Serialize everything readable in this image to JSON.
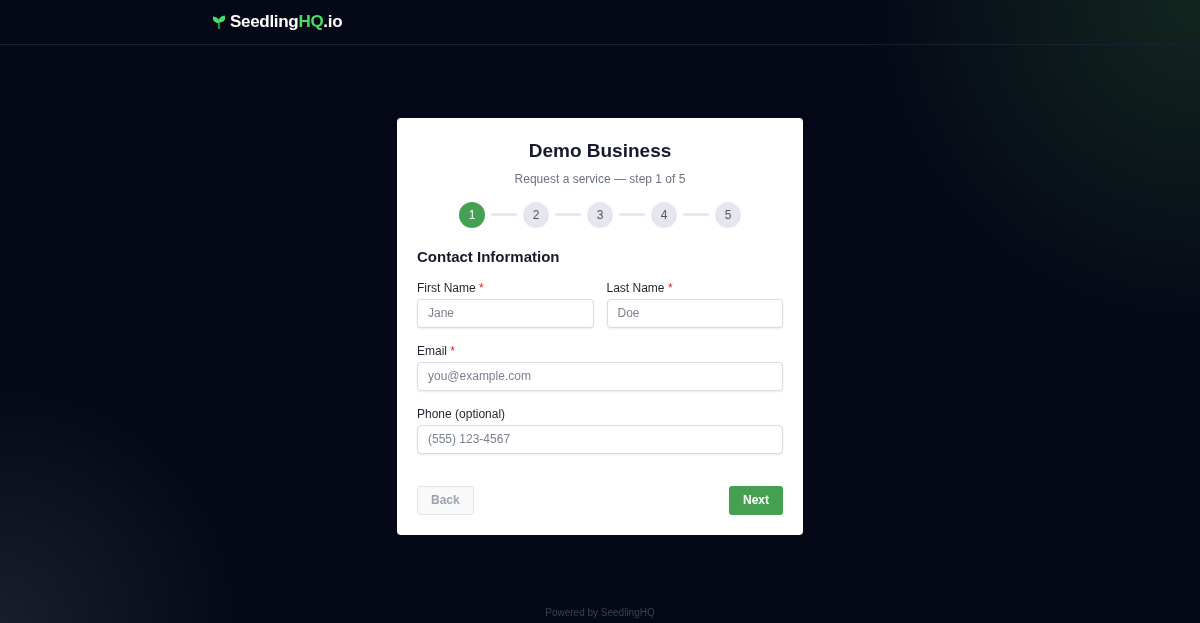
{
  "header": {
    "logo": {
      "name": "Seedling",
      "accent": "HQ",
      "suffix": ".io"
    }
  },
  "card": {
    "title": "Demo Business",
    "subtitle": "Request a service — step 1 of 5",
    "steps": [
      {
        "label": "1",
        "selected": true
      },
      {
        "label": "2",
        "selected": false
      },
      {
        "label": "3",
        "selected": false
      },
      {
        "label": "4",
        "selected": false
      },
      {
        "label": "5",
        "selected": false
      }
    ],
    "section_title": "Contact Information",
    "rows": [
      [
        {
          "label": "First Name",
          "required_mark": "*",
          "placeholder": "Jane"
        },
        {
          "label": "Last Name",
          "required_mark": "*",
          "placeholder": "Doe"
        }
      ],
      [
        {
          "label": "Email",
          "required_mark": "*",
          "placeholder": "you@example.com"
        }
      ],
      [
        {
          "label": "Phone (optional)",
          "placeholder": "(555) 123-4567"
        }
      ]
    ],
    "buttons": [
      {
        "kind": "secondary",
        "label": "Back",
        "disabled": true
      },
      {
        "kind": "primary",
        "label": "Next",
        "disabled": false
      }
    ]
  },
  "footer": {
    "text": "Powered by SeedlingHQ"
  }
}
